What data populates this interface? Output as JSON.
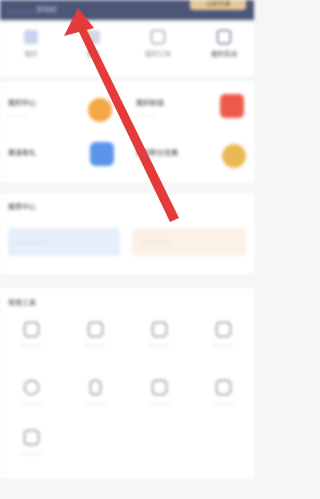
{
  "header": {
    "promo_text": "…………享特权",
    "open_button": "立即开通"
  },
  "quick_nav": [
    {
      "label": "我的",
      "icon": "wallet-icon"
    },
    {
      "label": "我的",
      "icon": "record-icon"
    },
    {
      "label": "我的订单",
      "icon": "order-icon"
    },
    {
      "label": "我的互动",
      "icon": "chat-icon"
    }
  ],
  "services": [
    {
      "label": "我的中心",
      "sub": "…………",
      "color": "#f5a845"
    },
    {
      "label": "我的权益",
      "sub": "…………",
      "color": "#ee5a4a"
    },
    {
      "label": "邀请有礼",
      "sub": "",
      "color": "#5b93ea"
    },
    {
      "label": "我的积分兑换",
      "sub": "",
      "color": "#e9b957"
    }
  ],
  "section": {
    "title": "推荐中心",
    "left_pill": "……………",
    "right_pill": "……………"
  },
  "tools": {
    "title": "常用工具",
    "items": [
      {
        "label": "…………",
        "icon": "document-icon"
      },
      {
        "label": "…………",
        "icon": "gift-icon"
      },
      {
        "label": "…………",
        "icon": "folder-icon"
      },
      {
        "label": "…………",
        "icon": "message-icon"
      },
      {
        "label": "…………",
        "icon": "headset-icon"
      },
      {
        "label": "…………",
        "icon": "phone-icon"
      },
      {
        "label": "…………",
        "icon": "calendar-icon"
      },
      {
        "label": "…………",
        "icon": "settings-icon"
      },
      {
        "label": "…………",
        "icon": "cart-icon"
      }
    ]
  },
  "colors": {
    "arrow": "#e53a3a",
    "header_bg": "#4c5778",
    "accent": "#e7c89a"
  }
}
